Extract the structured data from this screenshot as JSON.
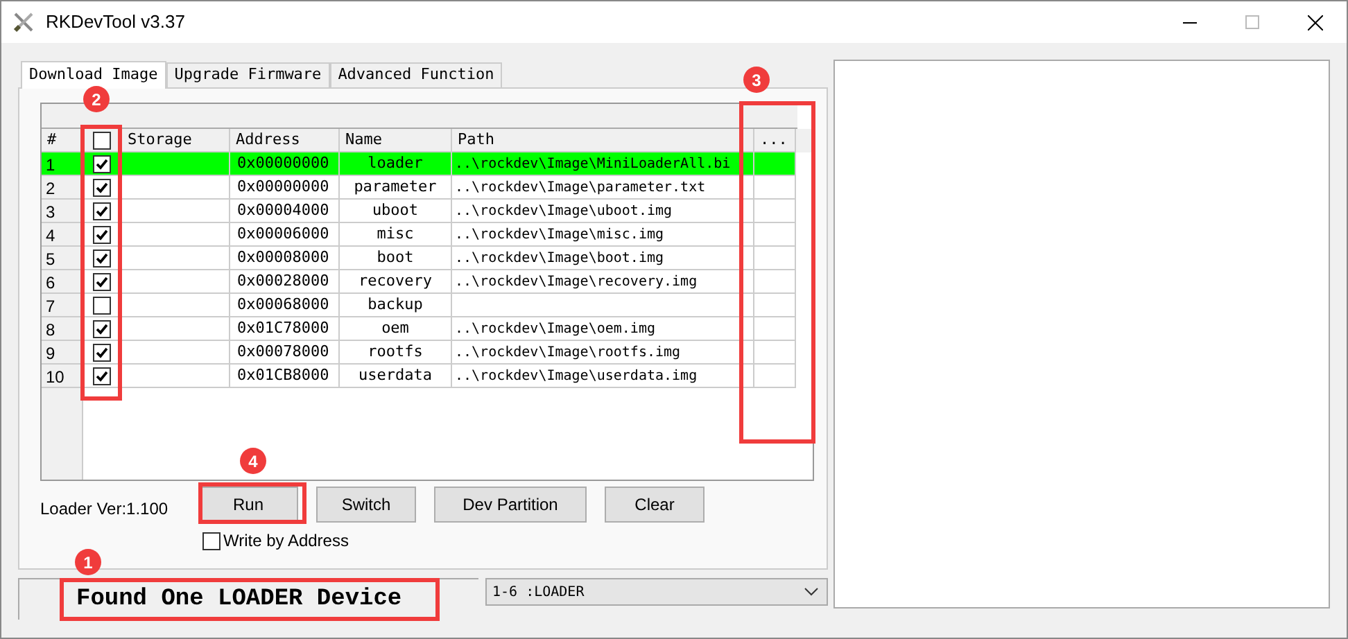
{
  "window": {
    "title": "RKDevTool v3.37"
  },
  "tabs": [
    {
      "label": "Download Image",
      "selected": true
    },
    {
      "label": "Upgrade Firmware",
      "selected": false
    },
    {
      "label": "Advanced Function",
      "selected": false
    }
  ],
  "table": {
    "select_all": {
      "checked": false
    },
    "columns": [
      "#",
      "Storage",
      "Address",
      "Name",
      "Path",
      "..."
    ],
    "rows": [
      {
        "index": "1",
        "checked": true,
        "selected": true,
        "address": "0x00000000",
        "name": "loader",
        "path": "..\\rockdev\\Image\\MiniLoaderAll.bi"
      },
      {
        "index": "2",
        "checked": true,
        "selected": false,
        "address": "0x00000000",
        "name": "parameter",
        "path": "..\\rockdev\\Image\\parameter.txt"
      },
      {
        "index": "3",
        "checked": true,
        "selected": false,
        "address": "0x00004000",
        "name": "uboot",
        "path": "..\\rockdev\\Image\\uboot.img"
      },
      {
        "index": "4",
        "checked": true,
        "selected": false,
        "address": "0x00006000",
        "name": "misc",
        "path": "..\\rockdev\\Image\\misc.img"
      },
      {
        "index": "5",
        "checked": true,
        "selected": false,
        "address": "0x00008000",
        "name": "boot",
        "path": "..\\rockdev\\Image\\boot.img"
      },
      {
        "index": "6",
        "checked": true,
        "selected": false,
        "address": "0x00028000",
        "name": "recovery",
        "path": "..\\rockdev\\Image\\recovery.img"
      },
      {
        "index": "7",
        "checked": false,
        "selected": false,
        "address": "0x00068000",
        "name": "backup"
      },
      {
        "index": "8",
        "checked": true,
        "selected": false,
        "address": "0x01C78000",
        "name": "oem",
        "path": "..\\rockdev\\Image\\oem.img"
      },
      {
        "index": "9",
        "checked": true,
        "selected": false,
        "address": "0x00078000",
        "name": "rootfs",
        "path": "..\\rockdev\\Image\\rootfs.img"
      },
      {
        "index": "10",
        "checked": true,
        "selected": false,
        "address": "0x01CB8000",
        "name": "userdata",
        "path": "..\\rockdev\\Image\\userdata.img"
      }
    ]
  },
  "loader_version": "Loader Ver:1.100",
  "buttons": [
    "Run",
    "Switch",
    "Dev Partition",
    "Clear"
  ],
  "write_by_address": {
    "label": "Write by Address",
    "checked": false
  },
  "status": "Found One LOADER Device",
  "device_select": {
    "value": "1-6 :LOADER"
  },
  "annotations": [
    "1",
    "2",
    "3",
    "4"
  ]
}
